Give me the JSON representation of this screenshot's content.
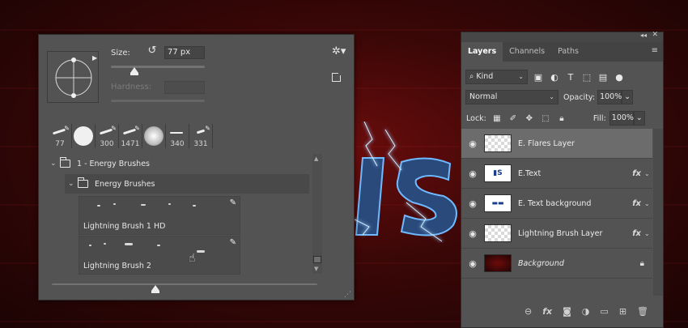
{
  "brush_panel": {
    "size_label": "Size:",
    "size_value": "77 px",
    "hardness_label": "Hardness:",
    "size_slider": 0.25,
    "hardness_slider": 0,
    "recent_brushes": [
      {
        "size": "77"
      },
      {
        "size": ""
      },
      {
        "size": "300"
      },
      {
        "size": "1471"
      },
      {
        "size": ""
      },
      {
        "size": "340"
      },
      {
        "size": "331"
      }
    ],
    "tree": {
      "group_1": "1 - Energy Brushes",
      "group_2": "Energy Brushes",
      "items": [
        {
          "label": "Lightning Brush 1 HD"
        },
        {
          "label": "Lightning Brush 2"
        }
      ]
    },
    "preview_slider": 0.39
  },
  "layers_panel": {
    "tabs": [
      {
        "label": "Layers",
        "active": true
      },
      {
        "label": "Channels",
        "active": false
      },
      {
        "label": "Paths",
        "active": false
      }
    ],
    "filter_kind": "Kind",
    "blend_mode": "Normal",
    "opacity_label": "Opacity:",
    "opacity_value": "100%",
    "lock_label": "Lock:",
    "fill_label": "Fill:",
    "fill_value": "100%",
    "layers": [
      {
        "name": "E. Flares Layer",
        "selected": true,
        "fx": false,
        "thumb": "transparent"
      },
      {
        "name": "E.Text",
        "selected": false,
        "fx": true,
        "thumb": "text"
      },
      {
        "name": "E. Text background",
        "selected": false,
        "fx": true,
        "thumb": "text"
      },
      {
        "name": "Lightning Brush Layer",
        "selected": false,
        "fx": true,
        "thumb": "transparent"
      },
      {
        "name": "Background",
        "selected": false,
        "fx": false,
        "locked": true,
        "thumb": "dark"
      }
    ],
    "fx_symbol": "fx"
  },
  "colors": {
    "panel_bg": "#535353",
    "selected_row": "#6c6c6c",
    "canvas_red": "#5a0a0a",
    "lightning_blue": "#4aa8ff"
  }
}
